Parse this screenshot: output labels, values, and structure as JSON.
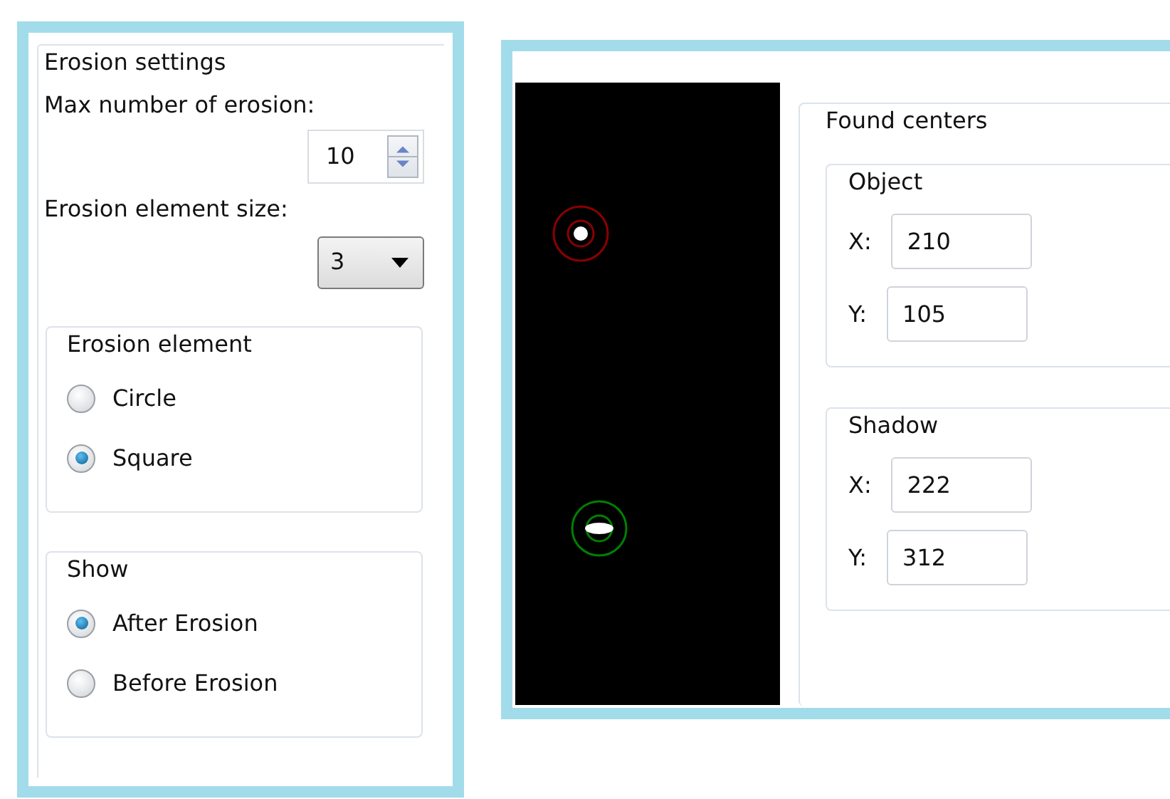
{
  "erosion_settings": {
    "title": "Erosion settings",
    "max_label": "Max number of erosion:",
    "max_value": "10",
    "size_label": "Erosion element size:",
    "size_value": "3",
    "groups": [
      {
        "title": "Erosion element",
        "options": [
          {
            "label": "Circle",
            "selected": false
          },
          {
            "label": "Square",
            "selected": true
          }
        ]
      },
      {
        "title": "Show",
        "options": [
          {
            "label": "After Erosion",
            "selected": true
          },
          {
            "label": "Before Erosion",
            "selected": false
          }
        ]
      }
    ]
  },
  "preview": {
    "markers": [
      {
        "kind": "object",
        "color": "#8b0000"
      },
      {
        "kind": "shadow",
        "color": "#008000"
      }
    ]
  },
  "found_centers": {
    "title": "Found centers",
    "groups": [
      {
        "title": "Object",
        "fields": [
          {
            "label": "X:",
            "value": "210"
          },
          {
            "label": "Y:",
            "value": "105"
          }
        ]
      },
      {
        "title": "Shadow",
        "fields": [
          {
            "label": "X:",
            "value": "222"
          },
          {
            "label": "Y:",
            "value": "312"
          }
        ]
      }
    ]
  }
}
